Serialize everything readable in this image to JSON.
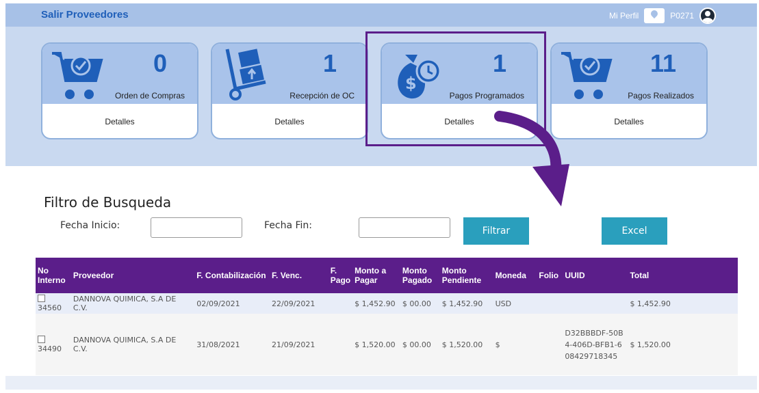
{
  "header": {
    "brand": "Salir Proveedores",
    "profile_label": "Mi Perfil",
    "user_code": "P0271"
  },
  "cards": [
    {
      "count": "0",
      "label": "Orden de Compras",
      "footer": "Detalles",
      "icon": "shopping-cart-icon"
    },
    {
      "count": "1",
      "label": "Recepción de OC",
      "footer": "Detalles",
      "icon": "hand-truck-icon"
    },
    {
      "count": "1",
      "label": "Pagos Programados",
      "footer": "Detalles",
      "icon": "money-bag-clock-icon"
    },
    {
      "count": "11",
      "label": "Pagos Realizados",
      "footer": "Detalles",
      "icon": "shopping-cart-icon"
    }
  ],
  "filter": {
    "title": "Filtro de Busqueda",
    "fecha_inicio_label": "Fecha Inicio:",
    "fecha_inicio_value": "",
    "fecha_fin_label": "Fecha Fin:",
    "fecha_fin_value": "",
    "filtrar_label": "Filtrar",
    "excel_label": "Excel"
  },
  "table": {
    "columns": [
      "No Interno",
      "Proveedor",
      "F. Contabilización",
      "F. Venc.",
      "F. Pago",
      "Monto a Pagar",
      "Monto Pagado",
      "Monto Pendiente",
      "Moneda",
      "Folio",
      "UUID",
      "Total"
    ],
    "rows": [
      {
        "no_interno": "34560",
        "proveedor": "DANNOVA QUIMICA, S.A DE C.V.",
        "f_contabilizacion": "02/09/2021",
        "f_venc": "22/09/2021",
        "f_pago": "",
        "monto_pagar": "$ 1,452.90",
        "monto_pagado": "$ 00.00",
        "monto_pendiente": "$ 1,452.90",
        "moneda": "USD",
        "folio": "",
        "uuid": "",
        "total": "$ 1,452.90"
      },
      {
        "no_interno": "34490",
        "proveedor": "DANNOVA QUIMICA, S.A DE C.V.",
        "f_contabilizacion": "31/08/2021",
        "f_venc": "21/09/2021",
        "f_pago": "",
        "monto_pagar": "$ 1,520.00",
        "monto_pagado": "$ 00.00",
        "monto_pendiente": "$ 1,520.00",
        "moneda": "$",
        "folio": "",
        "uuid": "D32BBBDF-50B4-406D-BFB1-608429718345",
        "total": "$ 1,520.00"
      }
    ]
  },
  "colors": {
    "header_purple": "#5b1e8a",
    "button_teal": "#2a9fbd",
    "brand_blue": "#1f5fb9",
    "card_blue": "#a9c3ea"
  }
}
